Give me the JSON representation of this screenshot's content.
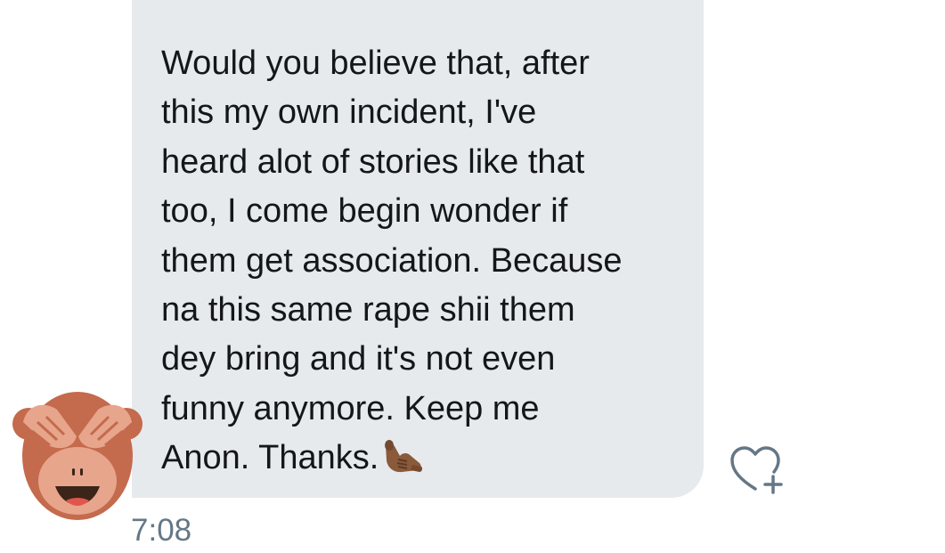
{
  "message": {
    "lines": [
      "Would you believe that, after",
      "this my own incident, I've",
      "heard alot of stories like that",
      "too, I come begin wonder if",
      "them get association. Because",
      "na this same rape shii them",
      "dey bring and it's not even",
      "funny anymore. Keep me",
      "Anon. Thanks."
    ],
    "trailing_emoji": "call-me-hand-emoji",
    "timestamp": "7:08"
  },
  "sender": {
    "avatar_icon": "see-no-evil-monkey-emoji"
  },
  "actions": {
    "like_icon": "heart-plus-icon"
  },
  "colors": {
    "bubble_background": "#e7eaed",
    "text": "#14171a",
    "timestamp": "#657786",
    "icon": "#657786",
    "monkey_fur": "#c46a4d",
    "monkey_face": "#e7a58c"
  }
}
